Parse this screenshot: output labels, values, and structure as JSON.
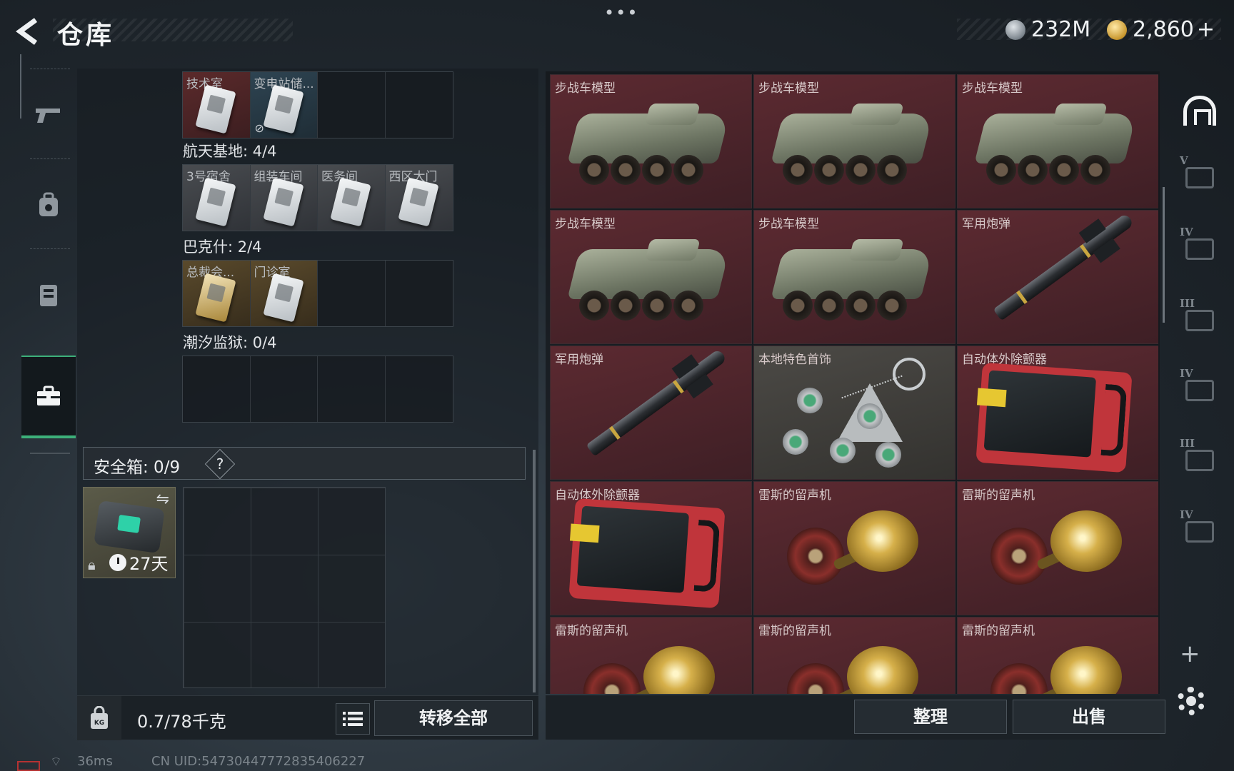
{
  "header": {
    "title": "仓库",
    "more": "•••",
    "currency_silver": "232M",
    "currency_gold": "2,860",
    "gold_plus": "+"
  },
  "left_nav": {
    "items": [
      {
        "icon": "pistol-icon"
      },
      {
        "icon": "backpack-icon"
      },
      {
        "icon": "vest-icon"
      },
      {
        "icon": "toolbox-icon",
        "active": true
      }
    ]
  },
  "key_rows": [
    {
      "section": "",
      "cells": [
        {
          "label": "技术室",
          "tone": "red",
          "card": true
        },
        {
          "label": "变电站储...",
          "tone": "blue",
          "card": true,
          "nosync": true
        },
        {
          "label": "",
          "tone": "",
          "card": false
        },
        {
          "label": "",
          "tone": "",
          "card": false
        }
      ]
    },
    {
      "section": "航天基地: 4/4",
      "cells": [
        {
          "label": "3号宿舍",
          "tone": "gray",
          "card": true
        },
        {
          "label": "组装车间",
          "tone": "gray",
          "card": true
        },
        {
          "label": "医务间",
          "tone": "gray",
          "card": true
        },
        {
          "label": "西区大门",
          "tone": "gray",
          "card": true
        }
      ]
    },
    {
      "section": "巴克什: 2/4",
      "cells": [
        {
          "label": "总裁会...",
          "tone": "gold",
          "card": true,
          "gold": true
        },
        {
          "label": "门诊室",
          "tone": "gold",
          "card": true
        },
        {
          "label": "",
          "tone": "",
          "card": false
        },
        {
          "label": "",
          "tone": "",
          "card": false
        }
      ]
    },
    {
      "section": "潮汐监狱: 0/4",
      "cells": [
        {
          "label": "",
          "tone": "",
          "card": false
        },
        {
          "label": "",
          "tone": "",
          "card": false
        },
        {
          "label": "",
          "tone": "",
          "card": false
        },
        {
          "label": "",
          "tone": "",
          "card": false
        }
      ]
    }
  ],
  "safe": {
    "title": "安全箱: 0/9",
    "help": "?",
    "timer": "27天"
  },
  "left_footer": {
    "weight": "0.7/78千克",
    "transfer_all": "转移全部"
  },
  "items": [
    {
      "name": "步战车模型",
      "kind": "apc",
      "tone": "red"
    },
    {
      "name": "步战车模型",
      "kind": "apc",
      "tone": "red"
    },
    {
      "name": "步战车模型",
      "kind": "apc",
      "tone": "red"
    },
    {
      "name": "步战车模型",
      "kind": "apc",
      "tone": "red"
    },
    {
      "name": "步战车模型",
      "kind": "apc",
      "tone": "red"
    },
    {
      "name": "军用炮弹",
      "kind": "missile",
      "tone": "red"
    },
    {
      "name": "军用炮弹",
      "kind": "missile",
      "tone": "red"
    },
    {
      "name": "本地特色首饰",
      "kind": "amulet",
      "tone": "gray"
    },
    {
      "name": "自动体外除颤器",
      "kind": "defib",
      "tone": "red"
    },
    {
      "name": "自动体外除颤器",
      "kind": "defib",
      "tone": "red"
    },
    {
      "name": "雷斯的留声机",
      "kind": "phono",
      "tone": "red"
    },
    {
      "name": "雷斯的留声机",
      "kind": "phono",
      "tone": "red"
    },
    {
      "name": "雷斯的留声机",
      "kind": "phono",
      "tone": "red"
    },
    {
      "name": "雷斯的留声机",
      "kind": "phono",
      "tone": "red"
    },
    {
      "name": "雷斯的留声机",
      "kind": "phono",
      "tone": "red"
    }
  ],
  "right_footer": {
    "sort": "整理",
    "sell": "出售"
  },
  "side_tabs": [
    {
      "roman": "",
      "icon": "home-icon"
    },
    {
      "roman": "V",
      "icon": "camera-icon"
    },
    {
      "roman": "IV",
      "icon": "folder-icon"
    },
    {
      "roman": "III",
      "icon": "camera-icon"
    },
    {
      "roman": "IV",
      "icon": "camera-icon"
    },
    {
      "roman": "III",
      "icon": "camera-icon"
    },
    {
      "roman": "IV",
      "icon": "camera-icon"
    }
  ],
  "side_plus": "+",
  "status": {
    "ping": "36ms",
    "uid": "CN UID:5473044777283540​6227"
  }
}
